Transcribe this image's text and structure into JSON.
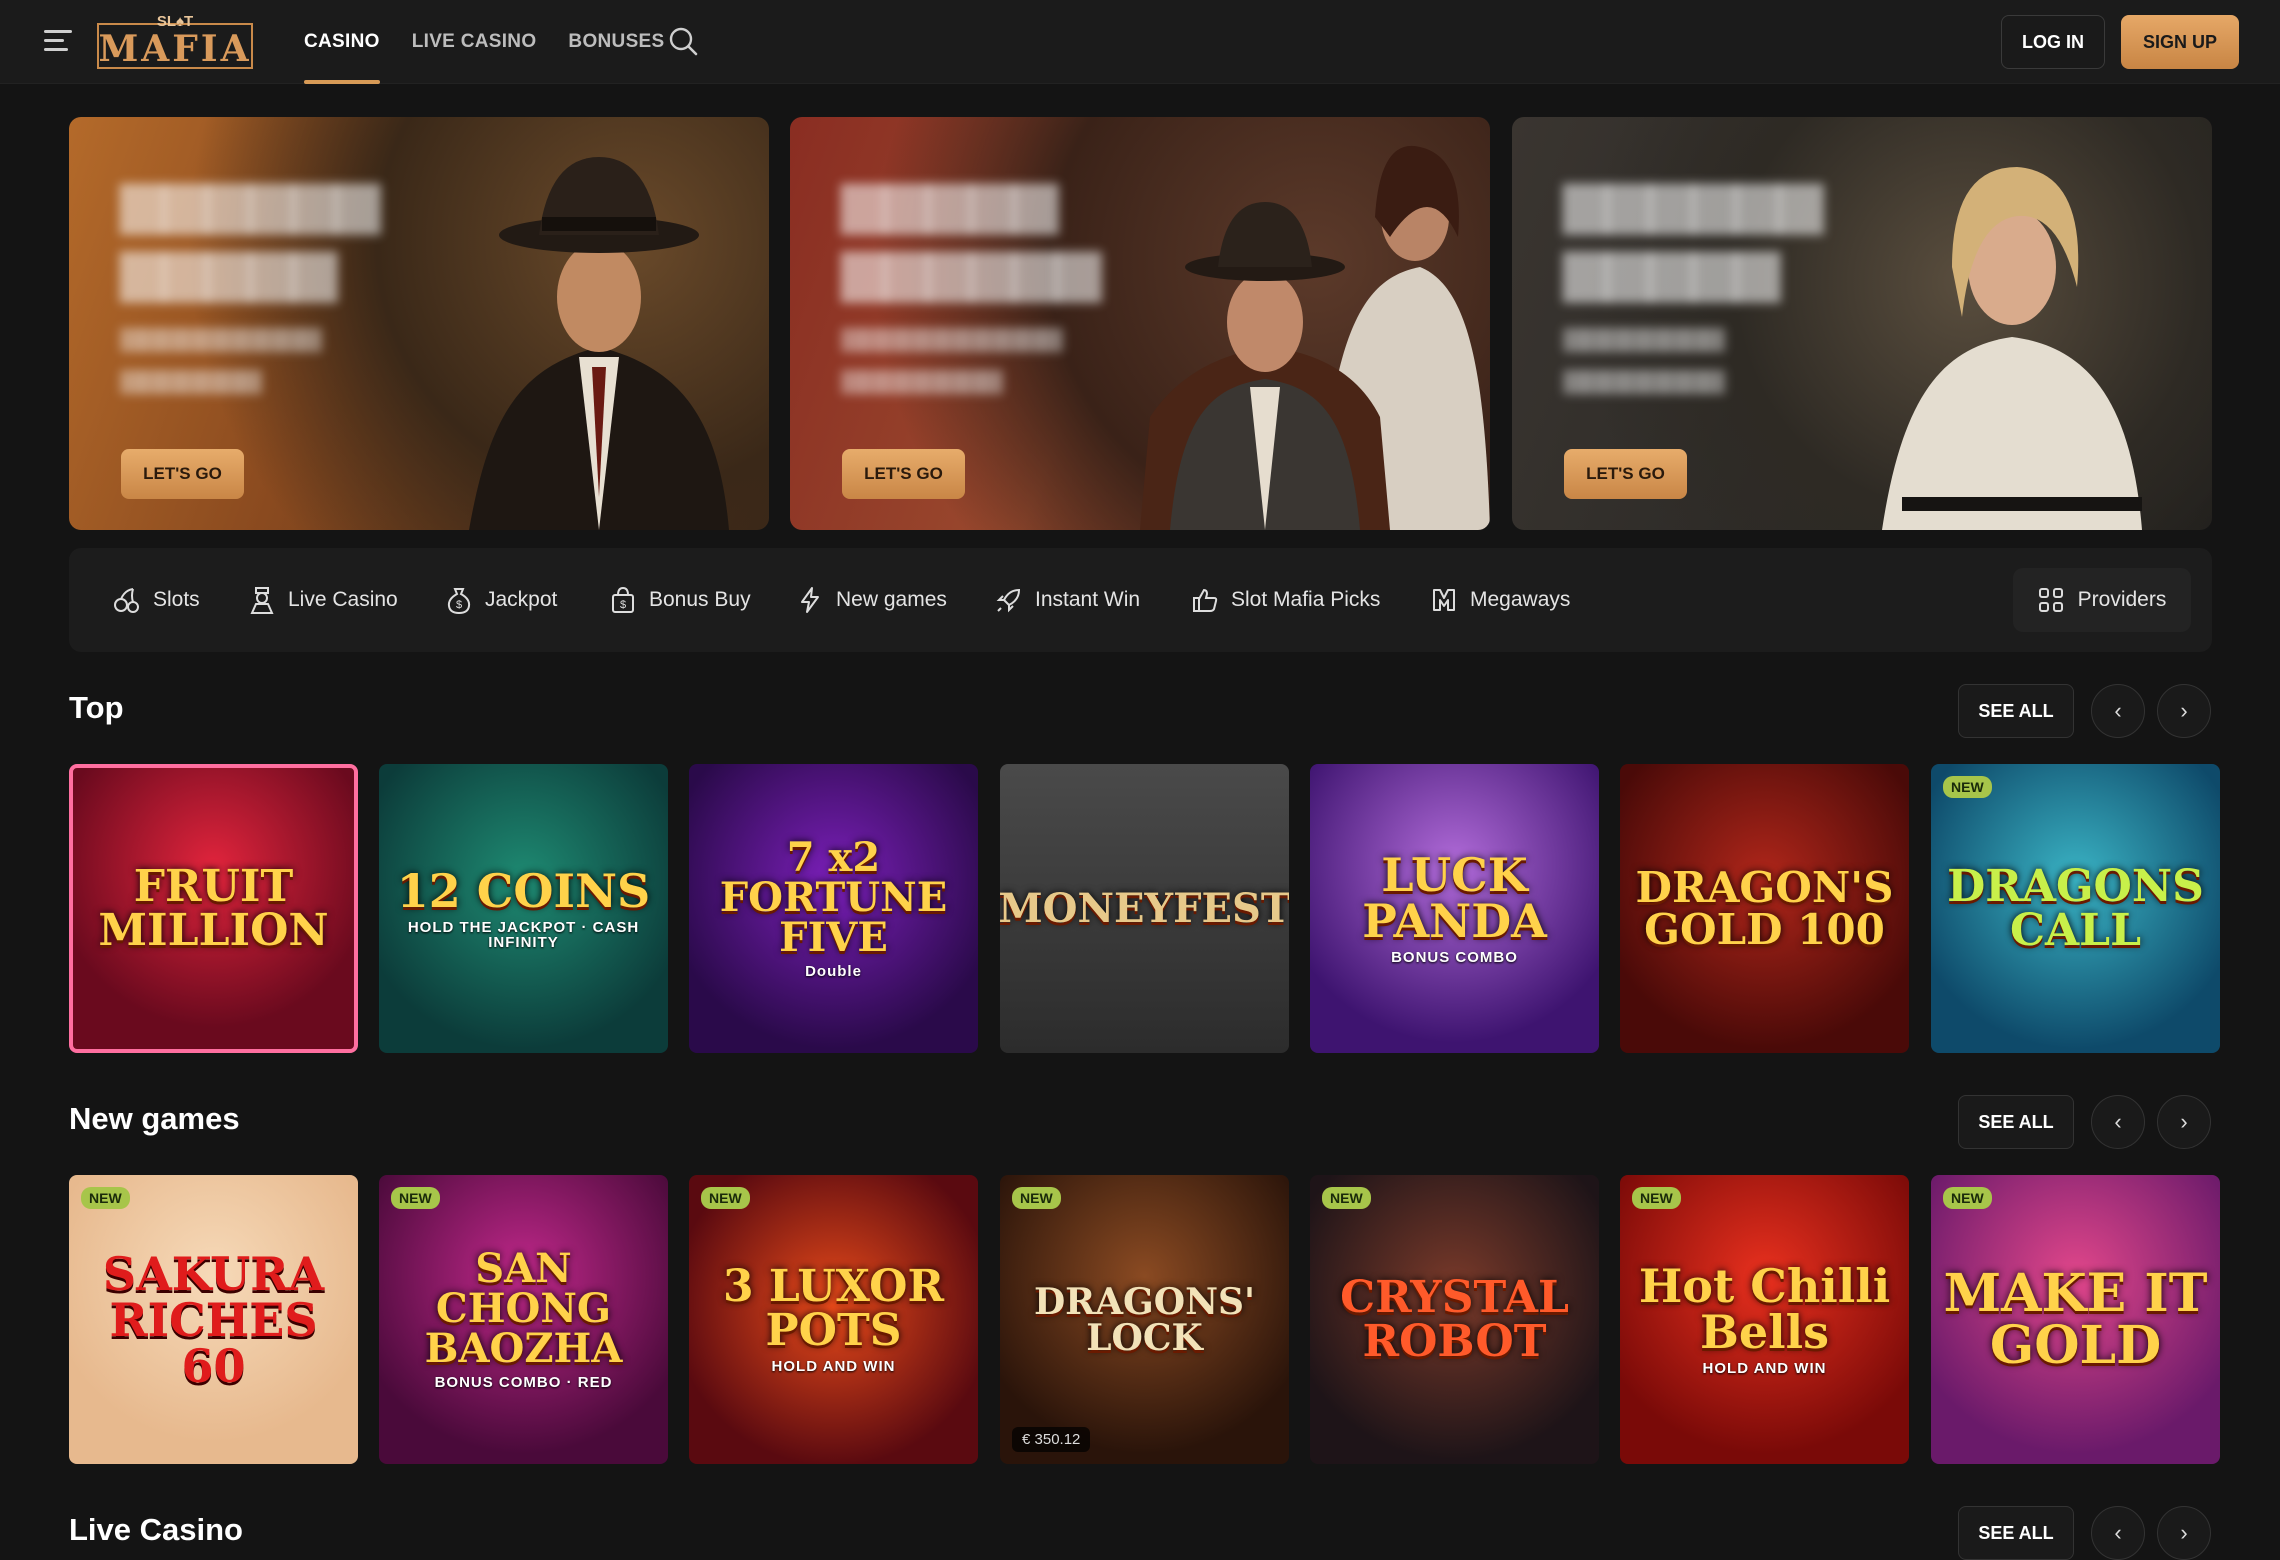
{
  "header": {
    "nav": [
      "CASINO",
      "LIVE CASINO",
      "BONUSES"
    ],
    "login": "LOG IN",
    "signup": "SIGN UP"
  },
  "banners": [
    {
      "cta": "LET'S GO"
    },
    {
      "cta": "LET'S GO"
    },
    {
      "cta": "LET'S GO"
    }
  ],
  "categories": [
    "Slots",
    "Live Casino",
    "Jackpot",
    "Bonus Buy",
    "New games",
    "Instant Win",
    "Slot Mafia Picks",
    "Megaways"
  ],
  "providers": "Providers",
  "sections": {
    "top": {
      "title": "Top",
      "see_all": "SEE ALL"
    },
    "new_games": {
      "title": "New games",
      "see_all": "SEE ALL"
    },
    "live": {
      "title": "Live Casino",
      "see_all": "SEE ALL"
    }
  },
  "top_games": [
    {
      "title": "FRUIT MILLION",
      "sub": "",
      "badge": ""
    },
    {
      "title": "12 COINS",
      "sub": "HOLD THE JACKPOT · CASH INFINITY",
      "badge": ""
    },
    {
      "title": "7 x2 FORTUNE FIVE",
      "sub": "Double",
      "badge": ""
    },
    {
      "title": "MONEYFEST",
      "sub": "",
      "badge": ""
    },
    {
      "title": "LUCK PANDA",
      "sub": "BONUS COMBO",
      "badge": ""
    },
    {
      "title": "DRAGON'S GOLD 100",
      "sub": "",
      "badge": ""
    },
    {
      "title": "DRAGONS CALL",
      "sub": "",
      "badge": "NEW"
    }
  ],
  "new_games": [
    {
      "title": "SAKURA RICHES 60",
      "sub": "",
      "badge": "NEW"
    },
    {
      "title": "SAN CHONG BAOZHA",
      "sub": "BONUS COMBO · RED",
      "badge": "NEW"
    },
    {
      "title": "3 LUXOR POTS",
      "sub": "HOLD AND WIN",
      "badge": "NEW"
    },
    {
      "title": "DRAGONS' LOCK",
      "sub": "",
      "badge": "NEW",
      "price": "€ 350.12"
    },
    {
      "title": "CRYSTAL ROBOT",
      "sub": "",
      "badge": "NEW"
    },
    {
      "title": "Hot Chilli Bells",
      "sub": "HOLD AND WIN",
      "badge": "NEW"
    },
    {
      "title": "MAKE IT GOLD",
      "sub": "",
      "badge": "NEW"
    }
  ]
}
